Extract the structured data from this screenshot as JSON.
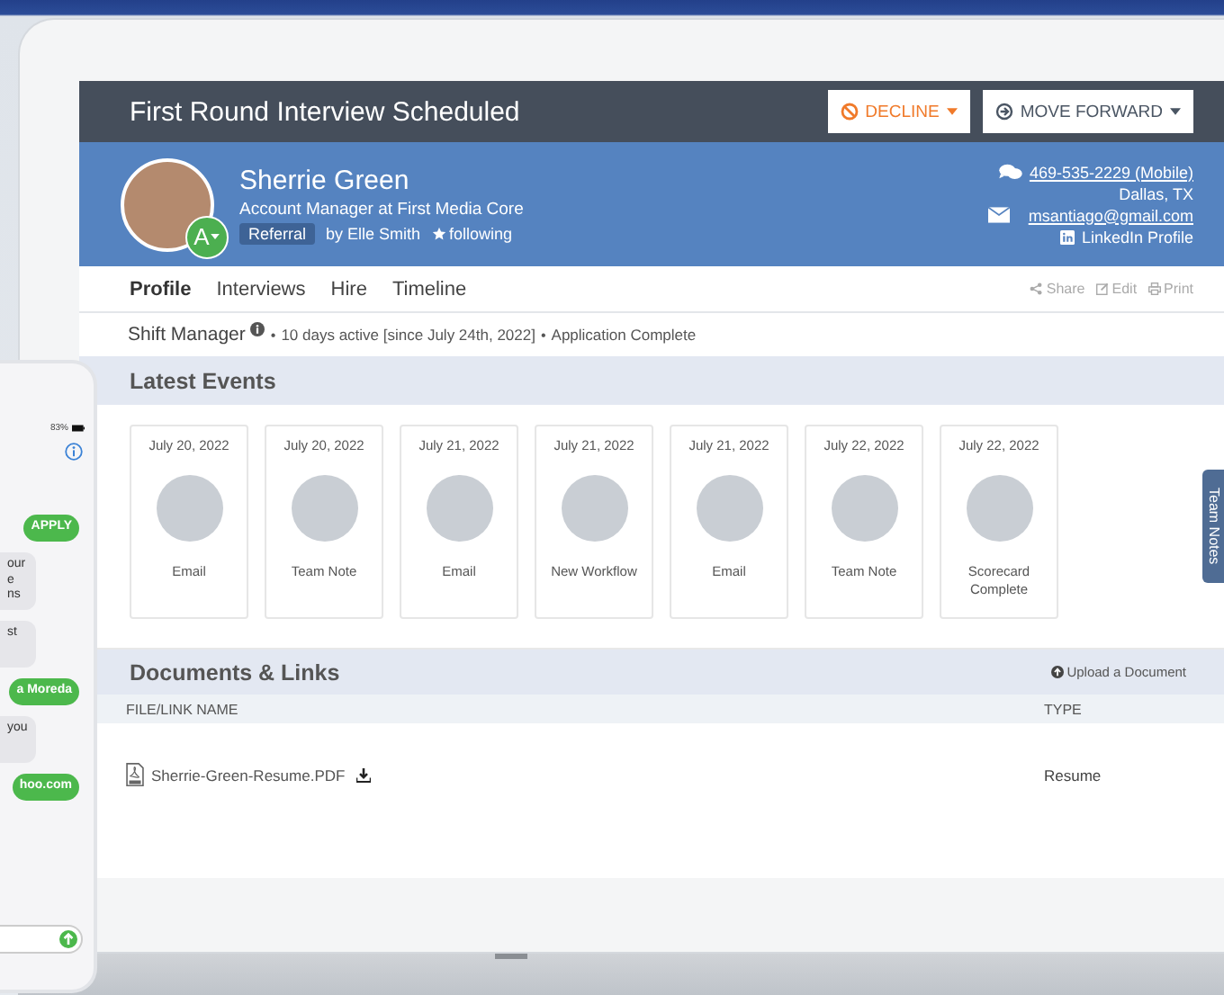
{
  "header": {
    "title": "First Round Interview Scheduled",
    "buttons": [
      {
        "label": "DECLINE",
        "kind": "decline"
      },
      {
        "label": "MOVE FORWARD",
        "kind": "forward"
      }
    ]
  },
  "candidate": {
    "name": "Sherrie Green",
    "title": "Account Manager at First Media Core",
    "grade": "A",
    "source_tag": "Referral",
    "referrer": "by Elle Smith",
    "following": "following",
    "phone": "469-535-2229 (Mobile)",
    "location": "Dallas, TX",
    "email": "msantiago@gmail.com",
    "linkedin": "LinkedIn Profile"
  },
  "tabs": [
    {
      "label": "Profile",
      "selected": true
    },
    {
      "label": "Interviews",
      "selected": false
    },
    {
      "label": "Hire",
      "selected": false
    },
    {
      "label": "Timeline",
      "selected": false
    }
  ],
  "actions": [
    {
      "label": "Share",
      "kind": "share"
    },
    {
      "label": "Edit",
      "kind": "edit"
    },
    {
      "label": "Print",
      "kind": "print"
    }
  ],
  "summary": {
    "separators": [
      "•",
      "•"
    ],
    "position": "Shift Manager",
    "active": "10 days active [since July 24th, 2022]",
    "status": "Application Complete"
  },
  "events": {
    "title": "Latest Events",
    "items": [
      {
        "date": "July 20, 2022",
        "label": "Email"
      },
      {
        "date": "July 20, 2022",
        "label": "Team Note"
      },
      {
        "date": "July 21, 2022",
        "label": "Email"
      },
      {
        "date": "July 21, 2022",
        "label": "New Workflow"
      },
      {
        "date": "July 21, 2022",
        "label": "Email"
      },
      {
        "date": "July 22, 2022",
        "label": "Team Note"
      },
      {
        "date": "July 22, 2022",
        "label": "Scorecard Complete"
      }
    ]
  },
  "documents": {
    "title": "Documents & Links",
    "upload": "Upload a Document",
    "columns": [
      "FILE/LINK NAME",
      "TYPE"
    ],
    "rows": [
      {
        "name": "Sherrie-Green-Resume.PDF",
        "type": "Resume"
      }
    ]
  },
  "side_tab": "Team Notes",
  "phone": {
    "battery": "83%",
    "messages": [
      {
        "kind": "sent",
        "lines": [
          "APPLY"
        ]
      },
      {
        "kind": "received",
        "lines": [
          "our",
          "e",
          "ns"
        ]
      },
      {
        "kind": "received",
        "lines": [
          "st"
        ]
      },
      {
        "kind": "sent",
        "lines": [
          "a Moreda"
        ]
      },
      {
        "kind": "received",
        "lines": [
          "you"
        ]
      },
      {
        "kind": "sent",
        "lines": [
          "hoo.com"
        ]
      }
    ]
  }
}
